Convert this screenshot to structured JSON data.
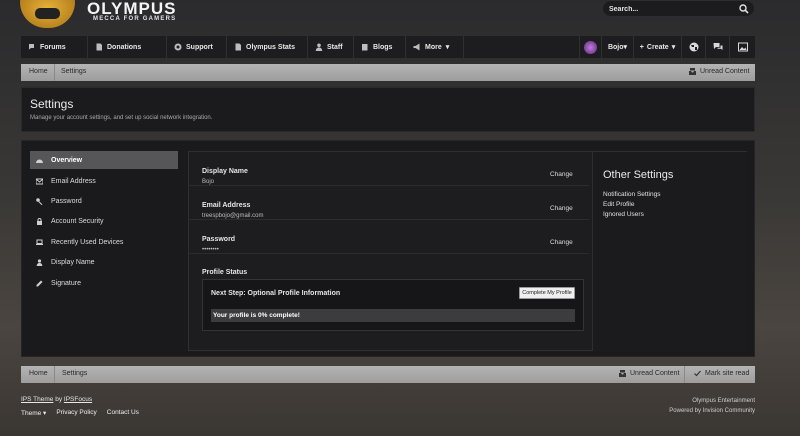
{
  "brand": {
    "title": "OLYMPUS",
    "subtitle": "MECCA FOR GAMERS"
  },
  "search": {
    "placeholder": "Search..."
  },
  "nav": {
    "items": [
      {
        "label": "Forums",
        "icon": "comments-icon"
      },
      {
        "label": "Donations",
        "icon": "document-icon"
      },
      {
        "label": "Support",
        "icon": "lifebuoy-icon"
      },
      {
        "label": "Olympus Stats",
        "icon": "document-icon"
      },
      {
        "label": "Staff",
        "icon": "user-icon"
      },
      {
        "label": "Blogs",
        "icon": "book-icon"
      },
      {
        "label": "More",
        "icon": "megaphone-icon"
      }
    ],
    "user_label": "Bojo",
    "create_label": "Create"
  },
  "breadcrumb_top": {
    "home": "Home",
    "current": "Settings",
    "unread": "Unread Content"
  },
  "settings_header": {
    "title": "Settings",
    "description": "Manage your account settings, and set up social network integration."
  },
  "sidebar": {
    "items": [
      {
        "label": "Overview",
        "icon": "dashboard-icon",
        "active": true
      },
      {
        "label": "Email Address",
        "icon": "envelope-icon",
        "active": false
      },
      {
        "label": "Password",
        "icon": "key-icon",
        "active": false
      },
      {
        "label": "Account Security",
        "icon": "lock-icon",
        "active": false
      },
      {
        "label": "Recently Used Devices",
        "icon": "laptop-icon",
        "active": false
      },
      {
        "label": "Display Name",
        "icon": "user-icon",
        "active": false
      },
      {
        "label": "Signature",
        "icon": "pencil-icon",
        "active": false
      }
    ]
  },
  "fields": [
    {
      "label": "Display Name",
      "value": "Bojo",
      "action": "Change"
    },
    {
      "label": "Email Address",
      "value": "treespbojo@gmail.com",
      "action": "Change"
    },
    {
      "label": "Password",
      "value": "••••••••",
      "action": "Change"
    }
  ],
  "profile_status": {
    "label": "Profile Status",
    "next_step": "Next Step: Optional Profile Information",
    "button": "Complete My Profile",
    "progress_text": "Your profile is 0% complete!",
    "progress_percent": 0
  },
  "other_settings": {
    "title": "Other Settings",
    "links": [
      "Notification Settings",
      "Edit Profile",
      "Ignored Users"
    ]
  },
  "breadcrumb_bottom": {
    "home": "Home",
    "current": "Settings",
    "unread": "Unread Content",
    "mark_read": "Mark site read"
  },
  "footer": {
    "theme_prefix": "IPS Theme",
    "theme_by": "by",
    "theme_author": "IPSFocus",
    "links": [
      "Theme",
      "Privacy Policy",
      "Contact Us"
    ],
    "copyright": "Olympus Entertainment",
    "powered": "Powered by Invision Community"
  }
}
